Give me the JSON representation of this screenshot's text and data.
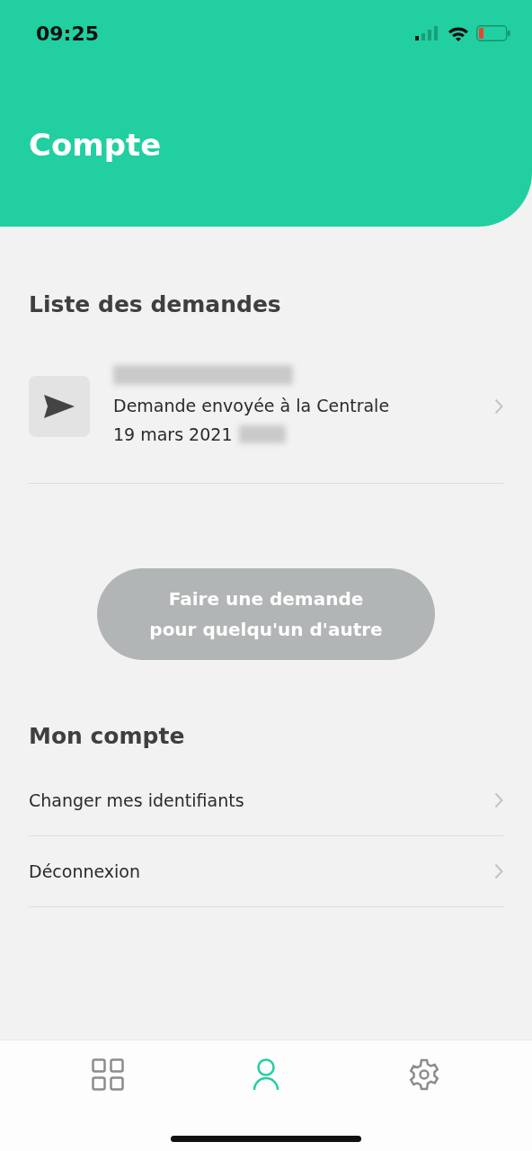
{
  "status_bar": {
    "time": "09:25"
  },
  "header": {
    "title": "Compte"
  },
  "requests": {
    "title": "Liste des demandes",
    "items": [
      {
        "name_redacted": true,
        "status": "Demande envoyée à la Centrale",
        "date": "19 mars 2021",
        "time_redacted": true
      }
    ]
  },
  "action_button": {
    "label": "Faire une demande\npour quelqu'un d'autre",
    "disabled": true
  },
  "account": {
    "title": "Mon compte",
    "items": [
      {
        "label": "Changer mes identifiants"
      },
      {
        "label": "Déconnexion"
      }
    ]
  },
  "tab_bar": [
    {
      "kind": "grid",
      "selected": false
    },
    {
      "kind": "person",
      "selected": true
    },
    {
      "kind": "settings",
      "selected": false
    }
  ]
}
